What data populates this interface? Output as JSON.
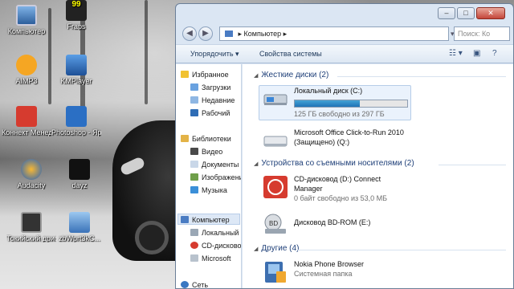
{
  "desktop": {
    "icons": [
      {
        "label": "Компьютер",
        "icon": "computer-icon"
      },
      {
        "label": "Fraps",
        "icon": "fraps-icon"
      },
      {
        "label": "AIMP3",
        "icon": "aimp-icon"
      },
      {
        "label": "KMPlayer",
        "icon": "kmplayer-icon"
      },
      {
        "label": "Коннект Менеджер",
        "icon": "connect-manager-icon"
      },
      {
        "label": "Photoshop - Ярлык",
        "icon": "photoshop-icon"
      },
      {
        "label": "Audacity",
        "icon": "audacity-icon"
      },
      {
        "label": "dayz",
        "icon": "dayz-icon"
      },
      {
        "label": "Токийский дрифт",
        "icon": "video-icon"
      },
      {
        "label": "zbWprt3kC...",
        "icon": "network-file-icon"
      }
    ],
    "fraps_counter": "99",
    "colors": {
      "aimp": "#f5a623",
      "connect": "#d63b2f",
      "photoshop": "#2b6fc4",
      "audacity": "#1f5fbf"
    }
  },
  "window": {
    "address": {
      "location": "Компьютер"
    },
    "search_placeholder": "Поиск: Ко",
    "controls": {
      "minimize": "–",
      "maximize": "□",
      "close": "✕"
    },
    "toolbar": {
      "organize": "Упорядочить ▾",
      "system_properties": "Свойства системы"
    },
    "nav_pane": [
      {
        "label": "Избранное",
        "icon": "favorites-star-icon"
      },
      {
        "label": "Загрузки",
        "icon": "downloads-folder-icon"
      },
      {
        "label": "Недавние",
        "icon": "recent-places-icon"
      },
      {
        "label": "Рабочий",
        "icon": "desktop-folder-icon"
      },
      {
        "label": "Библиотеки",
        "icon": "libraries-icon"
      },
      {
        "label": "Видео",
        "icon": "video-library-icon"
      },
      {
        "label": "Документы",
        "icon": "documents-library-icon"
      },
      {
        "label": "Изображения",
        "icon": "pictures-library-icon"
      },
      {
        "label": "Музыка",
        "icon": "music-library-icon"
      },
      {
        "label": "Компьютер",
        "icon": "computer-icon"
      },
      {
        "label": "Локальный",
        "icon": "local-disk-icon"
      },
      {
        "label": "CD-дисковод",
        "icon": "cd-drive-icon"
      },
      {
        "label": "Microsoft",
        "icon": "office-drive-icon"
      },
      {
        "label": "Сеть",
        "icon": "network-icon"
      }
    ],
    "groups": {
      "hard_disks": {
        "title": "Жесткие диски (2)"
      },
      "removable": {
        "title": "Устройства со съемными носителями (2)"
      },
      "other": {
        "title": "Другие (4)"
      }
    },
    "items": {
      "local_disk": {
        "name": "Локальный диск (C:)",
        "space": "125 ГБ свободно из 297 ГБ",
        "used_fraction": 0.58
      },
      "office": {
        "name": "Microsoft Office Click-to-Run 2010",
        "name2": "(Защищено) (Q:)"
      },
      "cd_drive": {
        "name": "CD-дисковод (D:) Connect",
        "name2": "Manager",
        "space": "0 байт свободно из 53,0 МБ"
      },
      "bd_rom": {
        "name": "Дисковод BD-ROM (E:)"
      },
      "nokia": {
        "name": "Nokia Phone Browser",
        "sub": "Системная папка"
      }
    }
  }
}
